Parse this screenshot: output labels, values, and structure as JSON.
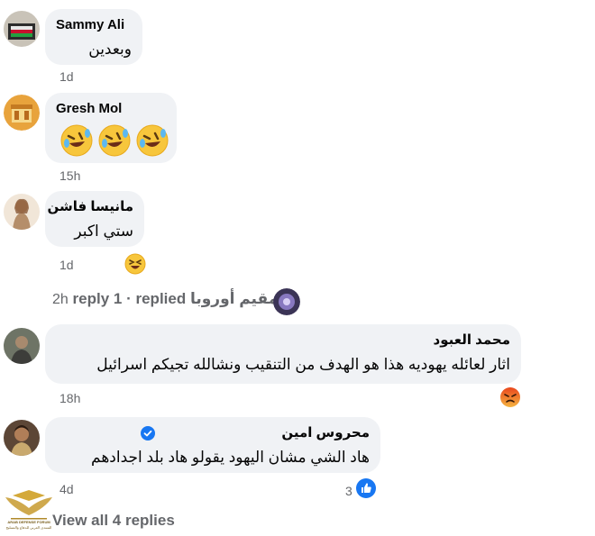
{
  "comments": [
    {
      "author": "Sammy Ali",
      "text": "وبعدين",
      "time": "1d"
    },
    {
      "author": "Gresh Mol",
      "time": "15h"
    },
    {
      "author": "مانيسا فاشن",
      "text": "ستي اكبر",
      "time": "1d"
    },
    {
      "author": "محمد العبود",
      "text": "اثار لعائله يهوديه هذا هو الهدف من التنقيب ونشالله تجيكم اسرائيل",
      "time": "18h"
    },
    {
      "author": "محروس امين",
      "text": "هاد الشي مشان اليهود يقولو هاد بلد اجدادهم",
      "time": "4d",
      "reaction_count": "3"
    }
  ],
  "reply_summary": {
    "meta": "2h",
    "replies": "reply 1",
    "separator": "·",
    "replied_text": "replied",
    "author": "مقيم أوروبا"
  },
  "view_all": "View all 4 replies",
  "watermark": {
    "line1": "ARAB DEFENSE FORUM",
    "line2": "المنتدى العربي للدفاع والتسليح"
  },
  "colors": {
    "bubble": "#f0f2f5",
    "meta": "#65676b",
    "verified": "#1877f2",
    "like": "#1877f2"
  }
}
